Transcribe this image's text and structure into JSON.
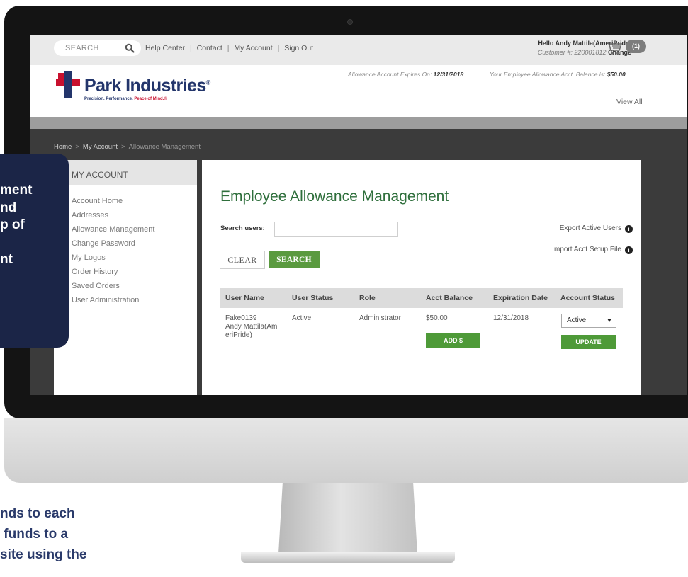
{
  "colors": {
    "brand_navy": "#23356b",
    "brand_red": "#c8102e",
    "accent_green": "#5a9a3f",
    "title_green": "#2f6f3c",
    "callout_bg": "#1b2547"
  },
  "topbar": {
    "search_placeholder": "SEARCH",
    "search_icon": "magnifier",
    "links": [
      "Help Center",
      "Contact",
      "My Account",
      "Sign Out"
    ],
    "separator": "|",
    "hello": "Hello Andy Mattila(AmeriPride)",
    "customer_prefix": "Customer #:",
    "customer_number": "220001812",
    "change_label": "Change",
    "cart_icon": "shopping-cart",
    "cart_count": "(1)"
  },
  "header": {
    "logo_name": "Park Industries",
    "logo_reg": "®",
    "tagline_prefix": "Precision. Performance.",
    "tagline_highlight": "Peace of Mind.",
    "tagline_reg": "®",
    "expires_label": "Allowance Account Expires On:",
    "expires_date": "12/31/2018",
    "balance_label": "Your Employee Allowance Acct. Balance is:",
    "balance_value": "$50.00",
    "view_all": "View All"
  },
  "breadcrumb": {
    "items": [
      "Home",
      "My Account",
      "Allowance Management"
    ],
    "separator": ">"
  },
  "sidebar": {
    "title": "MY ACCOUNT",
    "items": [
      "Account Home",
      "Addresses",
      "Allowance Management",
      "Change Password",
      "My Logos",
      "Order History",
      "Saved Orders",
      "User Administration"
    ]
  },
  "main": {
    "title": "Employee Allowance Management",
    "search_label": "Search users:",
    "search_value": "",
    "clear_label": "CLEAR",
    "search_button": "SEARCH",
    "export_label": "Export Active Users",
    "import_label": "Import Acct Setup File",
    "info_icon": "info-circle",
    "table": {
      "headers": [
        "User Name",
        "User Status",
        "Role",
        "Acct Balance",
        "Expiration Date",
        "Account Status"
      ],
      "rows": [
        {
          "user_id": "Fake0139",
          "user_name": "Andy Mattila(AmeriPride)",
          "user_status": "Active",
          "role": "Administrator",
          "acct_balance": "$50.00",
          "expiration": "12/31/2018",
          "account_status": "Active",
          "add_label": "ADD $",
          "update_label": "UPDATE"
        }
      ]
    }
  },
  "callout": {
    "lines": [
      "ment",
      "nd",
      "p of",
      "",
      "nt"
    ]
  },
  "bottom_text": {
    "lines": [
      "nds to each",
      " funds to a",
      "site using the"
    ]
  }
}
